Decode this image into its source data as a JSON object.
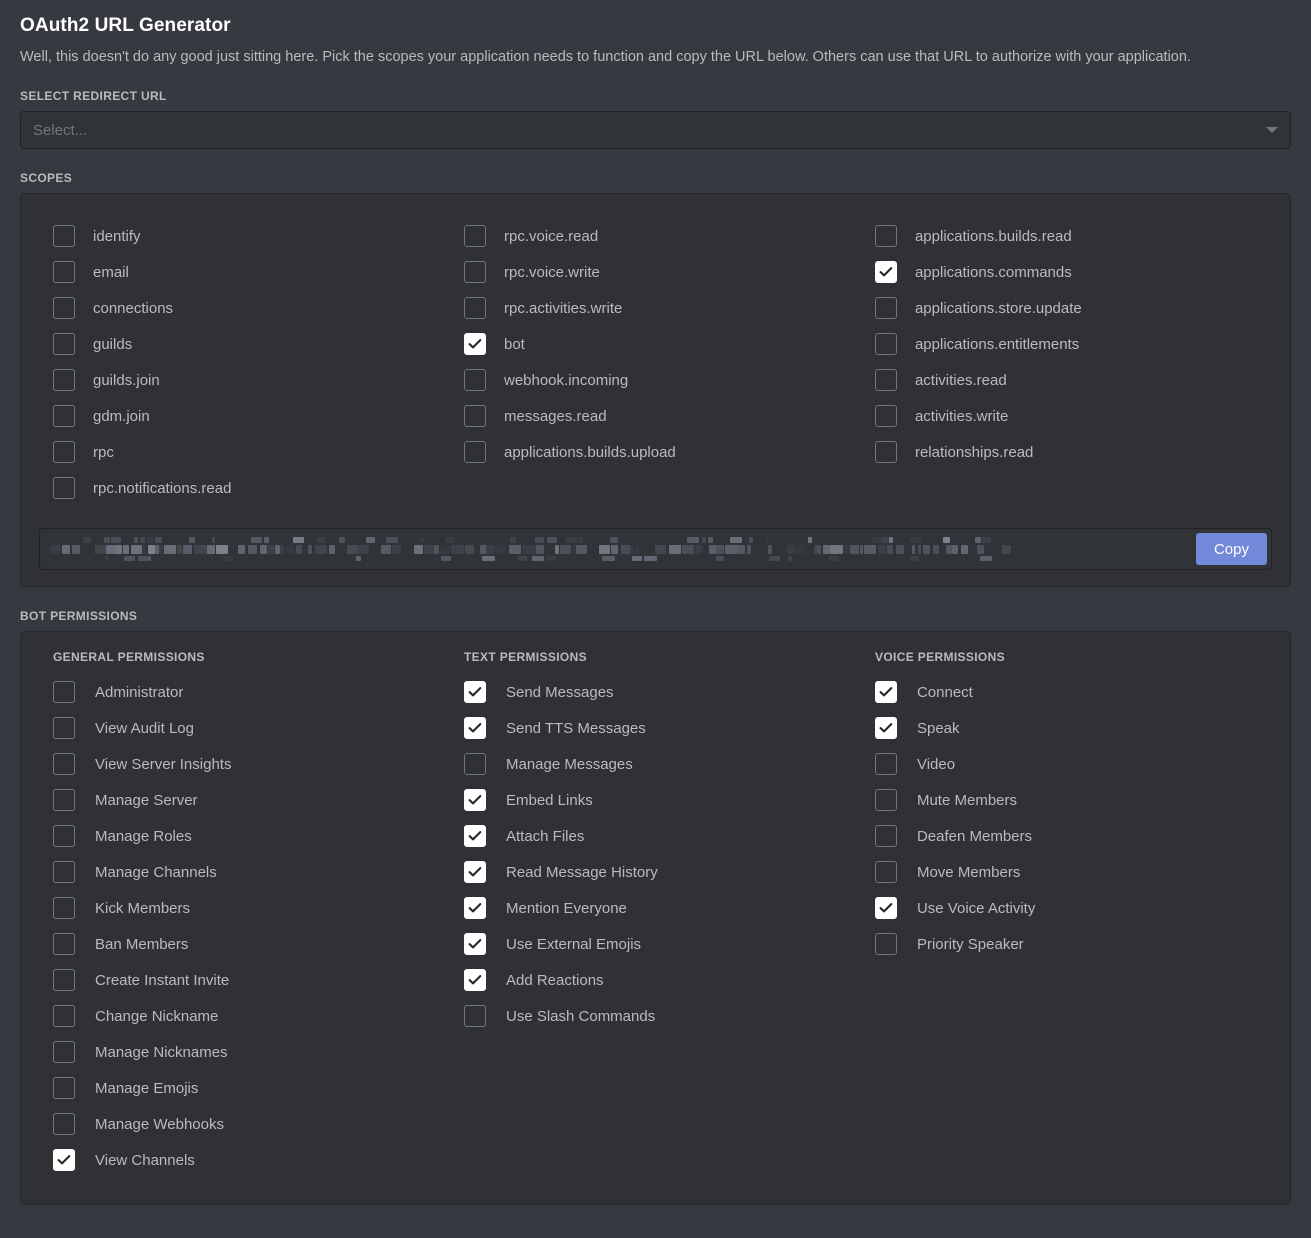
{
  "header": {
    "title": "OAuth2 URL Generator",
    "description": "Well, this doesn't do any good just sitting here. Pick the scopes your application needs to function and copy the URL below. Others can use that URL to authorize with your application."
  },
  "redirect": {
    "label": "SELECT REDIRECT URL",
    "placeholder": "Select...",
    "value": "",
    "arrow_icon": "chevron-down-icon"
  },
  "scopes": {
    "label": "SCOPES",
    "columns": [
      {
        "items": [
          {
            "label": "identify",
            "checked": false
          },
          {
            "label": "email",
            "checked": false
          },
          {
            "label": "connections",
            "checked": false
          },
          {
            "label": "guilds",
            "checked": false
          },
          {
            "label": "guilds.join",
            "checked": false
          },
          {
            "label": "gdm.join",
            "checked": false
          },
          {
            "label": "rpc",
            "checked": false
          },
          {
            "label": "rpc.notifications.read",
            "checked": false
          }
        ]
      },
      {
        "items": [
          {
            "label": "rpc.voice.read",
            "checked": false
          },
          {
            "label": "rpc.voice.write",
            "checked": false
          },
          {
            "label": "rpc.activities.write",
            "checked": false
          },
          {
            "label": "bot",
            "checked": true
          },
          {
            "label": "webhook.incoming",
            "checked": false
          },
          {
            "label": "messages.read",
            "checked": false
          },
          {
            "label": "applications.builds.upload",
            "checked": false
          }
        ]
      },
      {
        "items": [
          {
            "label": "applications.builds.read",
            "checked": false
          },
          {
            "label": "applications.commands",
            "checked": true
          },
          {
            "label": "applications.store.update",
            "checked": false
          },
          {
            "label": "applications.entitlements",
            "checked": false
          },
          {
            "label": "activities.read",
            "checked": false
          },
          {
            "label": "activities.write",
            "checked": false
          },
          {
            "label": "relationships.read",
            "checked": false
          }
        ]
      }
    ]
  },
  "generated_url": {
    "value": "",
    "redacted": true,
    "copy_label": "Copy"
  },
  "bot_permissions": {
    "label": "BOT PERMISSIONS",
    "columns": [
      {
        "header": "GENERAL PERMISSIONS",
        "items": [
          {
            "label": "Administrator",
            "checked": false
          },
          {
            "label": "View Audit Log",
            "checked": false
          },
          {
            "label": "View Server Insights",
            "checked": false
          },
          {
            "label": "Manage Server",
            "checked": false
          },
          {
            "label": "Manage Roles",
            "checked": false
          },
          {
            "label": "Manage Channels",
            "checked": false
          },
          {
            "label": "Kick Members",
            "checked": false
          },
          {
            "label": "Ban Members",
            "checked": false
          },
          {
            "label": "Create Instant Invite",
            "checked": false
          },
          {
            "label": "Change Nickname",
            "checked": false
          },
          {
            "label": "Manage Nicknames",
            "checked": false
          },
          {
            "label": "Manage Emojis",
            "checked": false
          },
          {
            "label": "Manage Webhooks",
            "checked": false
          },
          {
            "label": "View Channels",
            "checked": true
          }
        ]
      },
      {
        "header": "TEXT PERMISSIONS",
        "items": [
          {
            "label": "Send Messages",
            "checked": true
          },
          {
            "label": "Send TTS Messages",
            "checked": true
          },
          {
            "label": "Manage Messages",
            "checked": false
          },
          {
            "label": "Embed Links",
            "checked": true
          },
          {
            "label": "Attach Files",
            "checked": true
          },
          {
            "label": "Read Message History",
            "checked": true
          },
          {
            "label": "Mention Everyone",
            "checked": true
          },
          {
            "label": "Use External Emojis",
            "checked": true
          },
          {
            "label": "Add Reactions",
            "checked": true
          },
          {
            "label": "Use Slash Commands",
            "checked": false
          }
        ]
      },
      {
        "header": "VOICE PERMISSIONS",
        "items": [
          {
            "label": "Connect",
            "checked": true
          },
          {
            "label": "Speak",
            "checked": true
          },
          {
            "label": "Video",
            "checked": false
          },
          {
            "label": "Mute Members",
            "checked": false
          },
          {
            "label": "Deafen Members",
            "checked": false
          },
          {
            "label": "Move Members",
            "checked": false
          },
          {
            "label": "Use Voice Activity",
            "checked": true
          },
          {
            "label": "Priority Speaker",
            "checked": false
          }
        ]
      }
    ]
  },
  "colors": {
    "background": "#36393f",
    "panel": "#2f3136",
    "input": "#303338",
    "border": "#202225",
    "text_primary": "#ffffff",
    "text_secondary": "#b9bbbe",
    "text_muted": "#72767d",
    "accent_blurple": "#7289da"
  }
}
